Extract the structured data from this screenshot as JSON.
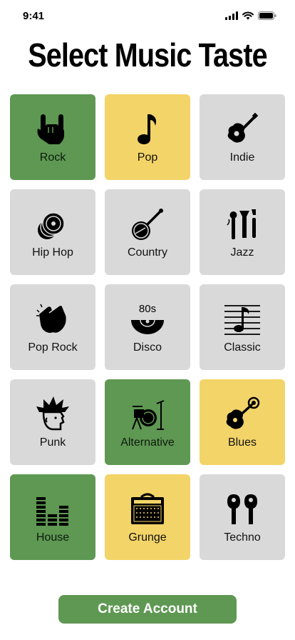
{
  "status_bar": {
    "time": "9:41"
  },
  "title": "Select Music Taste",
  "colors": {
    "green": "#5e9852",
    "yellow": "#f3d468",
    "gray": "#d9d9d9",
    "button": "#5e9852"
  },
  "genres": [
    {
      "label": "Rock",
      "icon": "rock-hand-icon",
      "state": "green"
    },
    {
      "label": "Pop",
      "icon": "music-note-icon",
      "state": "yellow"
    },
    {
      "label": "Indie",
      "icon": "acoustic-guitar-icon",
      "state": "gray"
    },
    {
      "label": "Hip Hop",
      "icon": "vinyl-records-icon",
      "state": "gray"
    },
    {
      "label": "Country",
      "icon": "banjo-icon",
      "state": "gray"
    },
    {
      "label": "Jazz",
      "icon": "jazz-instruments-icon",
      "state": "gray"
    },
    {
      "label": "Pop Rock",
      "icon": "clapping-hands-icon",
      "state": "gray"
    },
    {
      "label": "Disco",
      "icon": "80s-record-icon",
      "state": "gray",
      "icon_text": "80s"
    },
    {
      "label": "Classic",
      "icon": "sheet-music-icon",
      "state": "gray"
    },
    {
      "label": "Punk",
      "icon": "punk-head-icon",
      "state": "gray"
    },
    {
      "label": "Alternative",
      "icon": "drum-kit-icon",
      "state": "green"
    },
    {
      "label": "Blues",
      "icon": "blues-guitar-icon",
      "state": "yellow"
    },
    {
      "label": "House",
      "icon": "equalizer-icon",
      "state": "green"
    },
    {
      "label": "Grunge",
      "icon": "amplifier-icon",
      "state": "yellow"
    },
    {
      "label": "Techno",
      "icon": "earbuds-icon",
      "state": "gray"
    }
  ],
  "create_account_label": "Create Account"
}
